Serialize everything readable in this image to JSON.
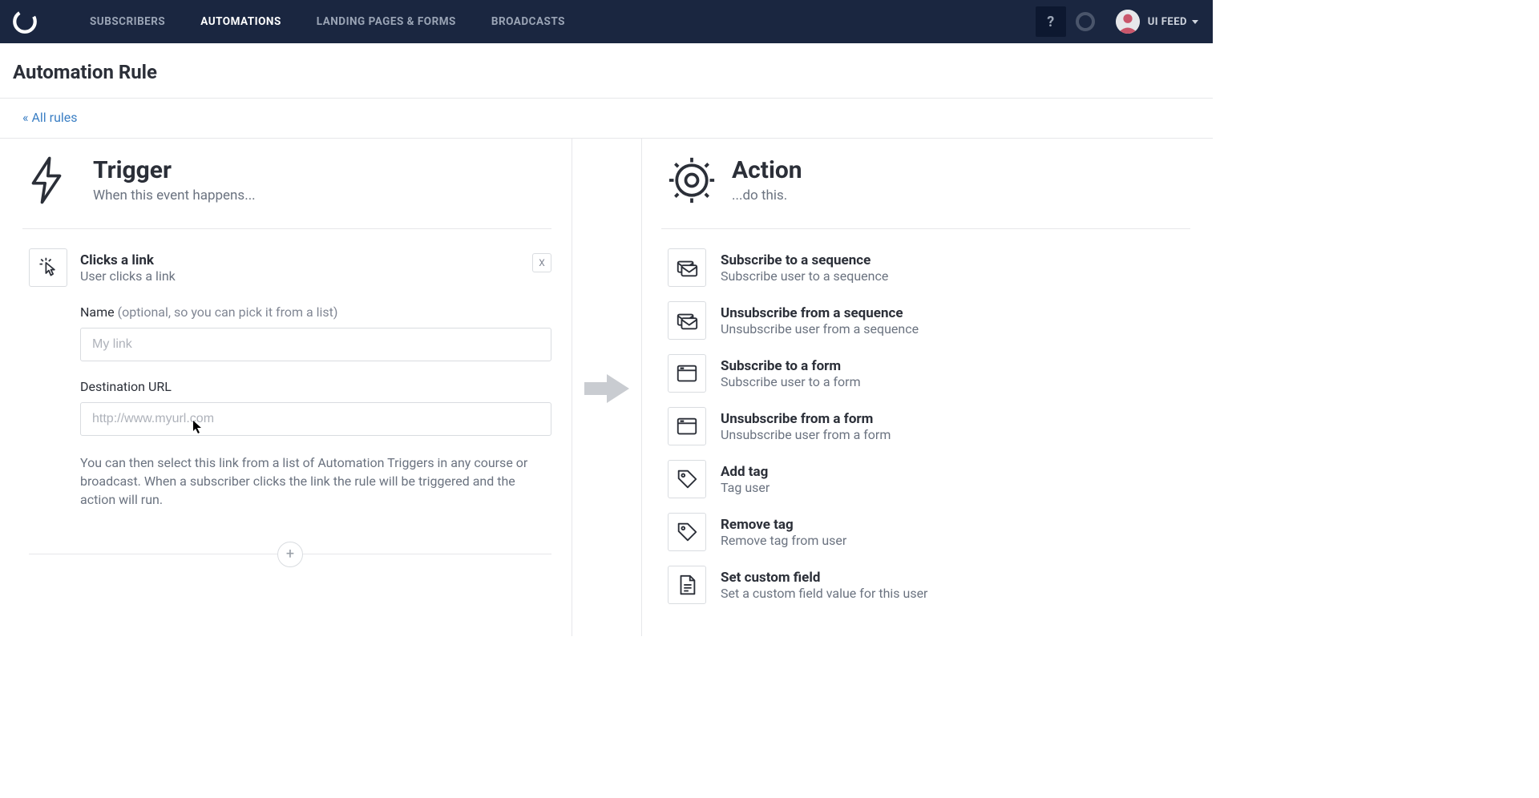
{
  "nav": {
    "items": [
      "SUBSCRIBERS",
      "AUTOMATIONS",
      "LANDING PAGES & FORMS",
      "BROADCASTS"
    ],
    "active_index": 1,
    "help_label": "?",
    "user_label": "UI FEED"
  },
  "page": {
    "title": "Automation Rule",
    "breadcrumb": "« All rules"
  },
  "trigger": {
    "heading": "Trigger",
    "subheading": "When this event happens...",
    "selected": {
      "title": "Clicks a link",
      "subtitle": "User clicks a link"
    },
    "remove_label": "X",
    "name_label": "Name ",
    "name_hint": "(optional, so you can pick it from a list)",
    "name_placeholder": "My link",
    "url_label": "Destination URL",
    "url_placeholder": "http://www.myurl.com",
    "help_text": "You can then select this link from a list of Automation Triggers in any course or broadcast. When a subscriber clicks the link the rule will be triggered and the action will run.",
    "add_label": "+"
  },
  "action": {
    "heading": "Action",
    "subheading": "...do this.",
    "items": [
      {
        "icon": "sequence",
        "title": "Subscribe to a sequence",
        "subtitle": "Subscribe user to a sequence"
      },
      {
        "icon": "sequence",
        "title": "Unsubscribe from a sequence",
        "subtitle": "Unsubscribe user from a sequence"
      },
      {
        "icon": "form",
        "title": "Subscribe to a form",
        "subtitle": "Subscribe user to a form"
      },
      {
        "icon": "form",
        "title": "Unsubscribe from a form",
        "subtitle": "Unsubscribe user from a form"
      },
      {
        "icon": "tag",
        "title": "Add tag",
        "subtitle": "Tag user"
      },
      {
        "icon": "tag",
        "title": "Remove tag",
        "subtitle": "Remove tag from user"
      },
      {
        "icon": "field",
        "title": "Set custom field",
        "subtitle": "Set a custom field value for this user"
      }
    ]
  },
  "icons": {
    "sequence": "sequence-icon",
    "form": "form-icon",
    "tag": "tag-icon",
    "field": "field-icon"
  }
}
